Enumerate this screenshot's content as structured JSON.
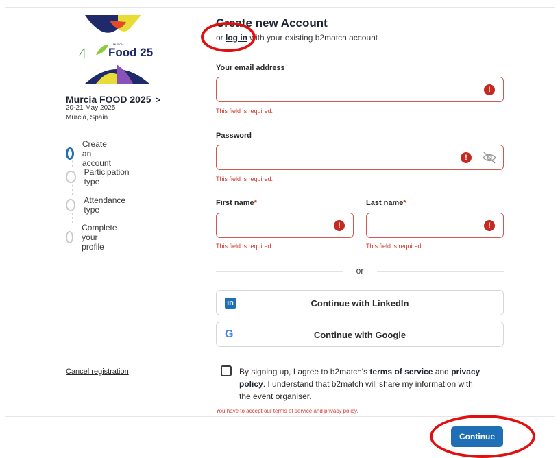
{
  "event": {
    "logo_text": "Food 25",
    "logo_mark": "MURCIA",
    "name": "Murcia FOOD 2025",
    "chevron": ">",
    "date": "20-21 May 2025",
    "location": "Murcia, Spain"
  },
  "steps": [
    {
      "label": "Create an account",
      "active": true
    },
    {
      "label": "Participation type",
      "active": false
    },
    {
      "label": "Attendance type",
      "active": false
    },
    {
      "label": "Complete your profile",
      "active": false
    }
  ],
  "cancel_label": "Cancel registration",
  "header": {
    "title": "Create new Account",
    "subtitle_prefix": "or",
    "login_link": "log in",
    "subtitle_suffix": "with your existing b2match account"
  },
  "form": {
    "email": {
      "label": "Your email address",
      "value": "",
      "error": "This field is required."
    },
    "password": {
      "label": "Password",
      "value": "",
      "error": "This field is required."
    },
    "first_name": {
      "label": "First name",
      "required_mark": "*",
      "value": "",
      "error": "This field is required."
    },
    "last_name": {
      "label": "Last name",
      "required_mark": "*",
      "value": "",
      "error": "This field is required."
    }
  },
  "divider_text": "or",
  "social": {
    "linkedin": {
      "icon": "in",
      "label": "Continue with LinkedIn"
    },
    "google": {
      "icon": "G",
      "label": "Continue with Google"
    }
  },
  "consent": {
    "text_1": "By signing up, I agree to b2match's",
    "terms": "terms of service",
    "text_2": "and",
    "privacy": "privacy policy",
    "text_3": ". I understand that b2match will share my information with the event organiser.",
    "error": "You have to accept our terms of service and privacy policy.",
    "checked": false
  },
  "continue_label": "Continue",
  "icons": {
    "error": "!",
    "error_icon_color": "#c42a20"
  },
  "colors": {
    "accent": "#1e6fb5",
    "error": "#d03a2f",
    "annotation": "#e01010"
  }
}
